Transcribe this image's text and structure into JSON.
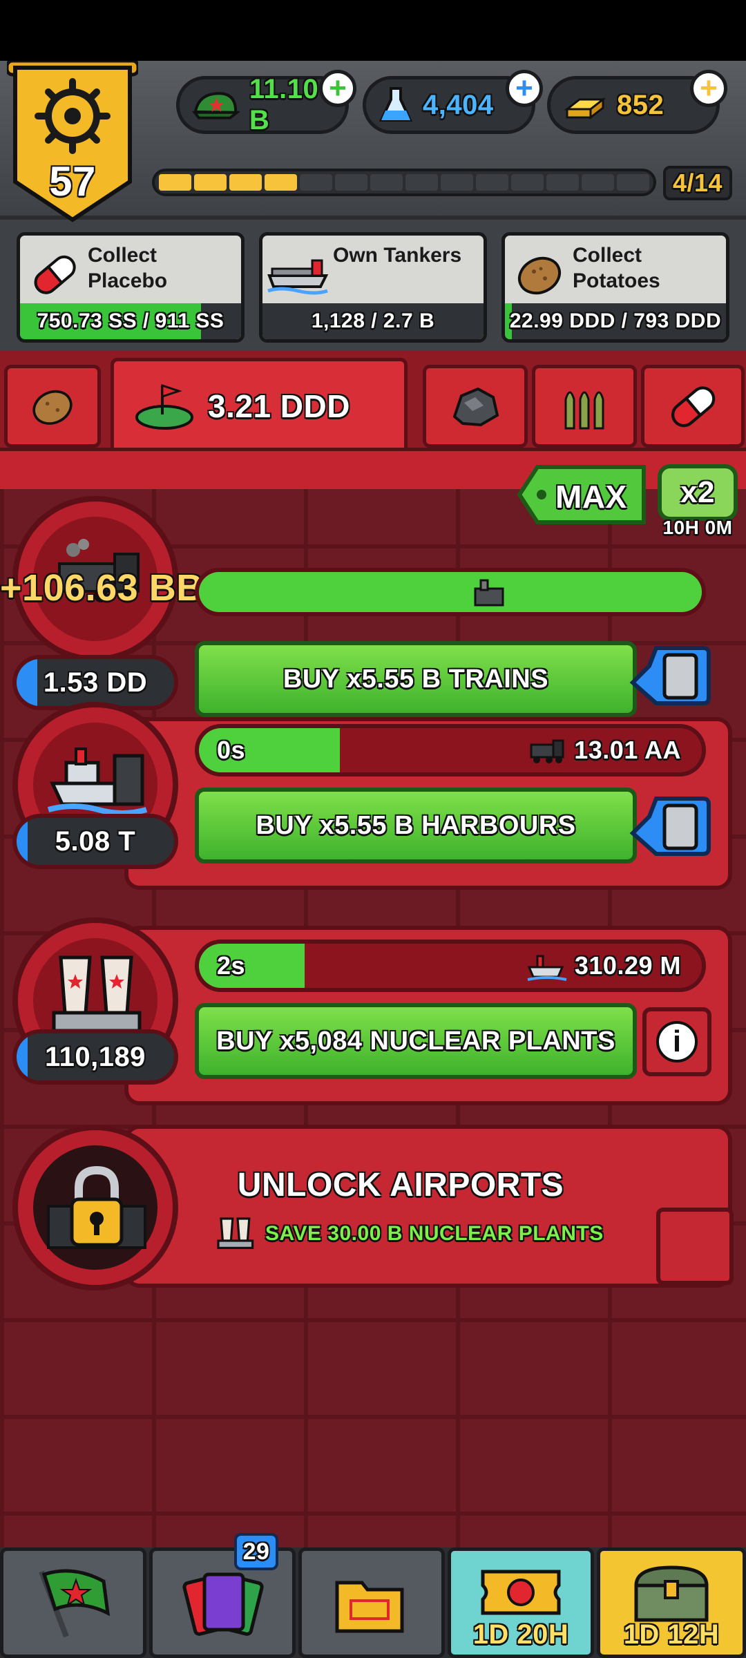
{
  "player": {
    "level": "57"
  },
  "resources": [
    {
      "icon": "cash-cap-icon",
      "value": "11.10 B",
      "color": "#39d04a"
    },
    {
      "icon": "science-flask-icon",
      "value": "4,404",
      "color": "#3aa5ff"
    },
    {
      "icon": "gold-bars-icon",
      "value": "852",
      "color": "#f6c33b"
    }
  ],
  "rank_progress": {
    "label": "4/14",
    "filled": 4,
    "total": 14
  },
  "quests": [
    {
      "title": "Collect\nPlacebo",
      "icon": "pill-icon",
      "progress_text": "750.73 SS / 911 SS",
      "fraction": 0.82
    },
    {
      "title": "Own Tankers",
      "icon": "tanker-ship-icon",
      "progress_text": "1,128 / 2.7 B",
      "fraction": 0.0
    },
    {
      "title": "Collect\nPotatoes",
      "icon": "potato-icon",
      "progress_text": "22.99 DDD / 793 DDD",
      "fraction": 0.03
    }
  ],
  "category_tabs": {
    "active_value": "3.21 DDD",
    "items": [
      "potato-tab",
      "land-flag-tab",
      "ore-tab",
      "ammo-tab",
      "pill-tab"
    ]
  },
  "multiplier": {
    "max_label": "MAX",
    "boost_label": "x2",
    "boost_timer": "10H 0M"
  },
  "factories": [
    {
      "name": "trains",
      "owned": "1.53 DD",
      "income": "+106.63 BB",
      "buy_label": "BUY x5.55 B TRAINS",
      "icon": "train-icon",
      "time": "",
      "produce": "",
      "fraction": 1.0
    },
    {
      "name": "harbours",
      "owned": "5.08 T",
      "time": "0s",
      "produce": "13.01 AA",
      "buy_label": "BUY x5.55 B HARBOURS",
      "icon": "harbour-ship-icon",
      "fraction": 0.28
    },
    {
      "name": "nuclear plants",
      "owned": "110,189",
      "time": "2s",
      "produce": "310.29 M",
      "buy_label": "BUY x5,084 NUCLEAR PLANTS",
      "icon": "nuclear-plant-icon",
      "fraction": 0.21
    }
  ],
  "locked": {
    "title": "UNLOCK AIRPORTS",
    "requirement": "SAVE 30.00 B NUCLEAR PLANTS"
  },
  "nav": [
    {
      "name": "flag",
      "label": ""
    },
    {
      "name": "cards",
      "label": "",
      "badge": "29"
    },
    {
      "name": "files",
      "label": ""
    },
    {
      "name": "event",
      "label": "1D 20H"
    },
    {
      "name": "chest",
      "label": "1D 12H"
    }
  ]
}
